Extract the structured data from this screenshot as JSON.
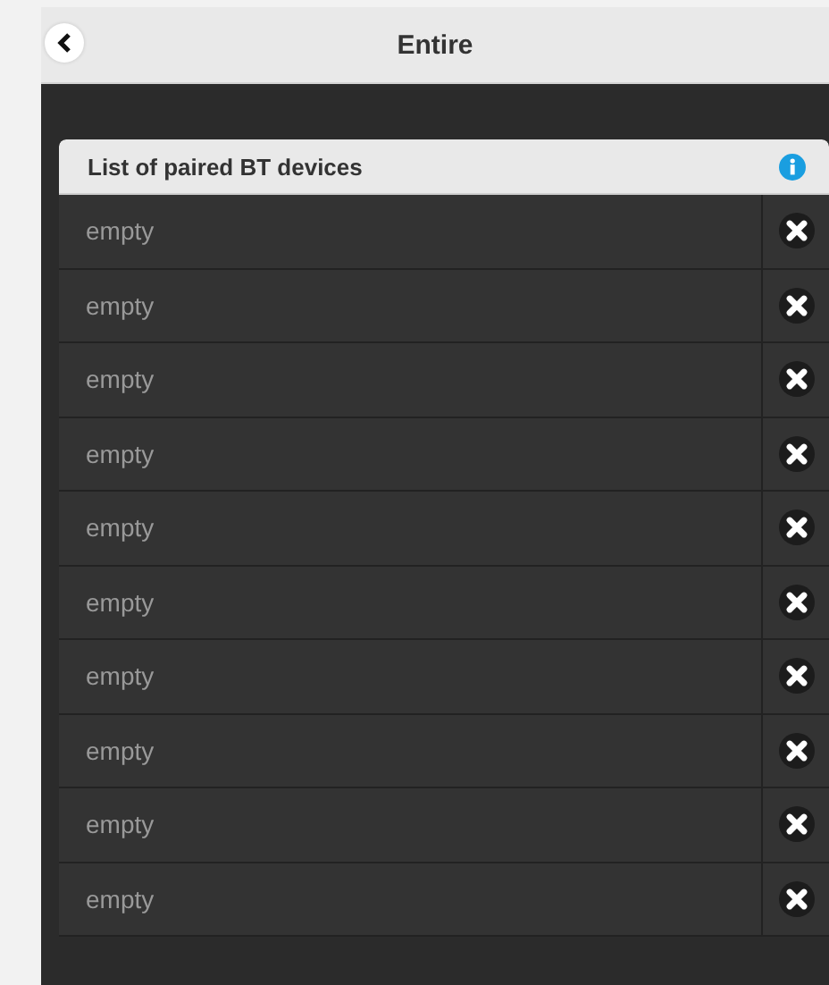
{
  "header": {
    "title": "Entire"
  },
  "list": {
    "title": "List of paired BT devices",
    "items": [
      {
        "label": "empty"
      },
      {
        "label": "empty"
      },
      {
        "label": "empty"
      },
      {
        "label": "empty"
      },
      {
        "label": "empty"
      },
      {
        "label": "empty"
      },
      {
        "label": "empty"
      },
      {
        "label": "empty"
      },
      {
        "label": "empty"
      },
      {
        "label": "empty"
      }
    ]
  }
}
